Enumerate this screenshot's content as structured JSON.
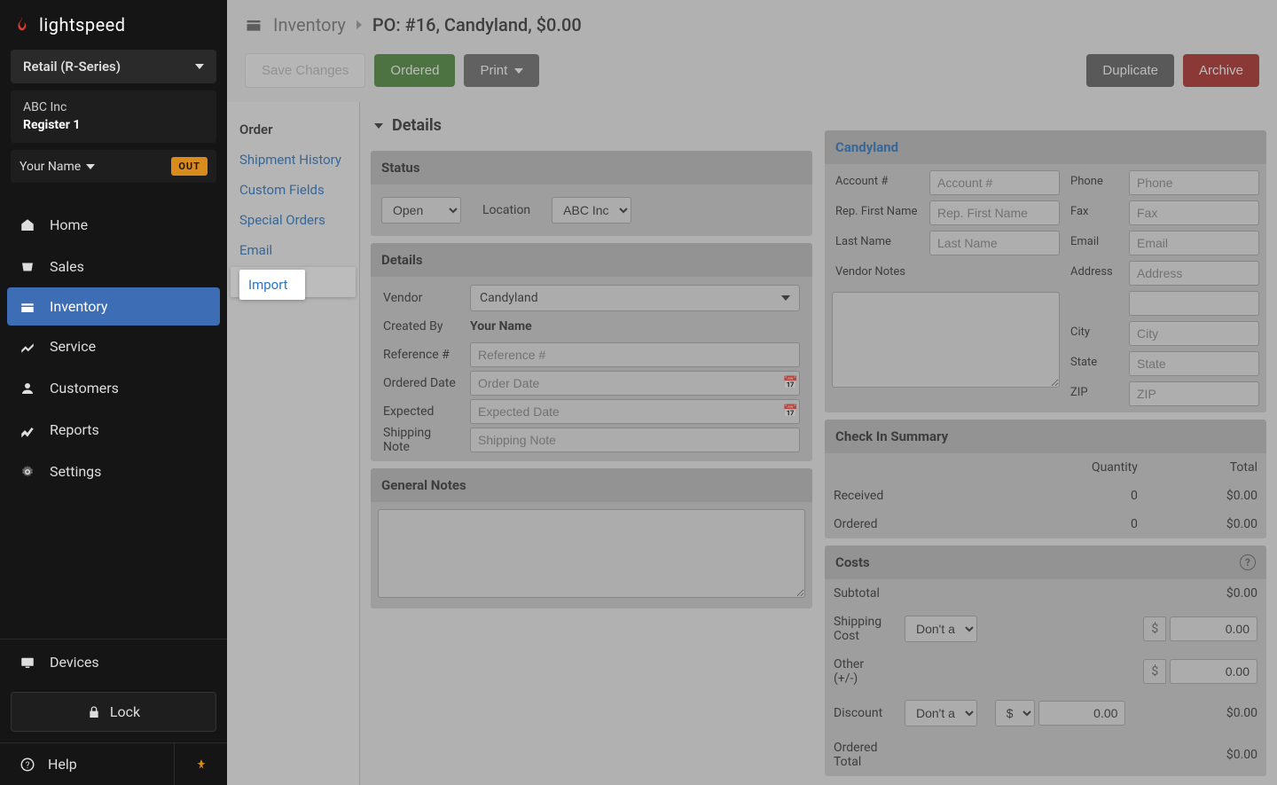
{
  "brand": "lightspeed",
  "series_selector": "Retail (R-Series)",
  "company": {
    "name": "ABC Inc",
    "register": "Register 1"
  },
  "user": {
    "name": "Your Name",
    "status_badge": "OUT"
  },
  "nav": {
    "home": "Home",
    "sales": "Sales",
    "inventory": "Inventory",
    "service": "Service",
    "customers": "Customers",
    "reports": "Reports",
    "settings": "Settings",
    "devices": "Devices",
    "lock": "Lock",
    "help": "Help"
  },
  "breadcrumb": {
    "link": "Inventory",
    "current": "PO:  #16, Candyland, $0.00"
  },
  "toolbar": {
    "save": "Save Changes",
    "ordered": "Ordered",
    "print": "Print",
    "duplicate": "Duplicate",
    "archive": "Archive"
  },
  "subnav": {
    "order": "Order",
    "shipment_history": "Shipment History",
    "custom_fields": "Custom Fields",
    "special_orders": "Special Orders",
    "email": "Email",
    "import": "Import"
  },
  "details_title": "Details",
  "status": {
    "header": "Status",
    "value": "Open",
    "location_label": "Location",
    "location_value": "ABC Inc"
  },
  "details": {
    "header": "Details",
    "vendor_label": "Vendor",
    "vendor_value": "Candyland",
    "created_by_label": "Created By",
    "created_by_value": "Your Name",
    "reference_label": "Reference #",
    "reference_placeholder": "Reference #",
    "ordered_date_label": "Ordered Date",
    "ordered_date_placeholder": "Order Date",
    "expected_label": "Expected",
    "expected_placeholder": "Expected Date",
    "shipping_note_label": "Shipping Note",
    "shipping_note_placeholder": "Shipping Note"
  },
  "general_notes": {
    "header": "General Notes"
  },
  "vendor": {
    "header": "Candyland",
    "account_label": "Account #",
    "account_placeholder": "Account #",
    "phone_label": "Phone",
    "phone_placeholder": "Phone",
    "rep_first_label": "Rep. First Name",
    "rep_first_placeholder": "Rep. First Name",
    "fax_label": "Fax",
    "fax_placeholder": "Fax",
    "last_name_label": "Last Name",
    "last_name_placeholder": "Last Name",
    "email_label": "Email",
    "email_placeholder": "Email",
    "notes_label": "Vendor Notes",
    "address_label": "Address",
    "address_placeholder": "Address",
    "city_label": "City",
    "city_placeholder": "City",
    "state_label": "State",
    "state_placeholder": "State",
    "zip_label": "ZIP",
    "zip_placeholder": "ZIP"
  },
  "checkin": {
    "header": "Check In Summary",
    "qty_col": "Quantity",
    "total_col": "Total",
    "received_label": "Received",
    "received_qty": "0",
    "received_total": "$0.00",
    "ordered_label": "Ordered",
    "ordered_qty": "0",
    "ordered_total": "$0.00"
  },
  "costs": {
    "header": "Costs",
    "subtotal_label": "Subtotal",
    "subtotal_value": "$0.00",
    "shipping_label": "Shipping Cost",
    "shipping_select": "Don't apply to items",
    "shipping_prefix": "$",
    "shipping_value": "0.00",
    "other_label": "Other (+/-)",
    "other_prefix": "$",
    "other_value": "0.00",
    "discount_label": "Discount",
    "discount_select": "Don't apply to items",
    "discount_unit": "$",
    "discount_input": "0.00",
    "discount_total": "$0.00",
    "ordered_total_label": "Ordered Total",
    "ordered_total_value": "$0.00"
  }
}
